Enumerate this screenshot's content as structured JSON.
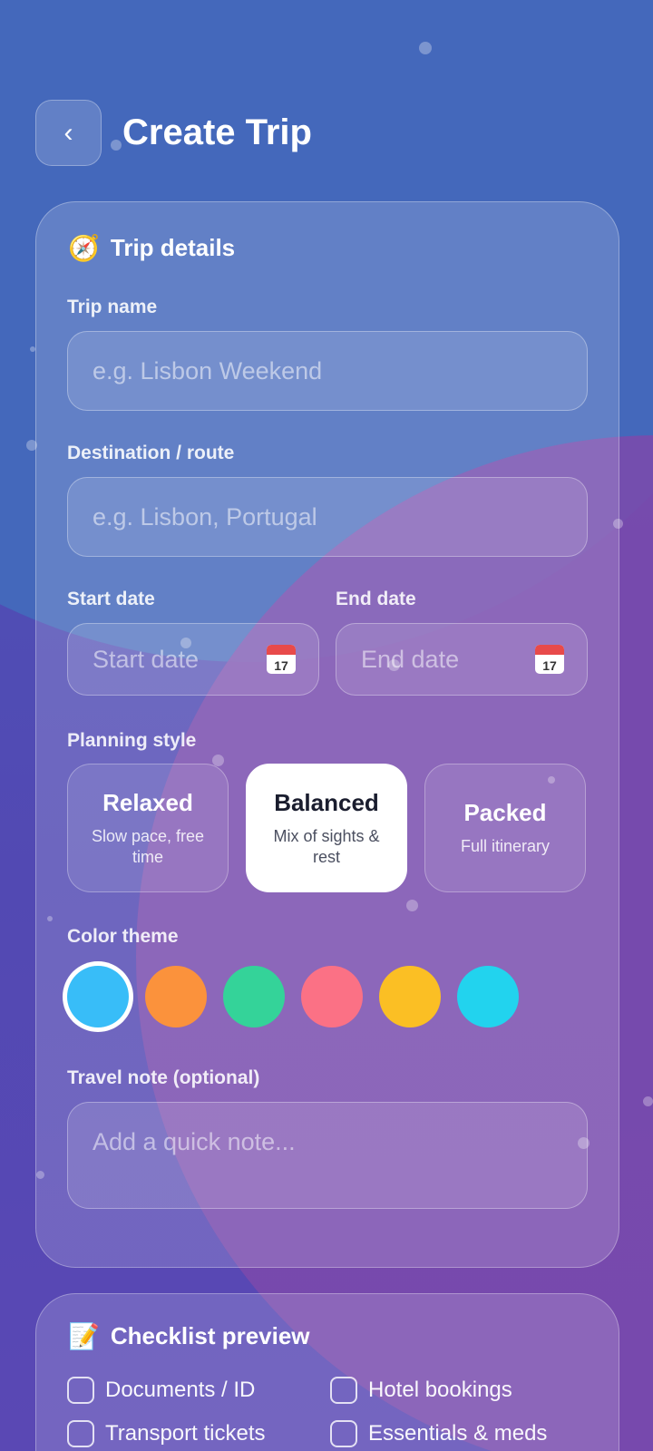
{
  "header": {
    "back_glyph": "‹",
    "title": "Create Trip"
  },
  "trip_details": {
    "emoji": "🧭",
    "title": "Trip details",
    "trip_name": {
      "label": "Trip name",
      "placeholder": "e.g. Lisbon Weekend",
      "value": ""
    },
    "destination": {
      "label": "Destination / route",
      "placeholder": "e.g. Lisbon, Portugal",
      "value": ""
    },
    "start_date": {
      "label": "Start date",
      "placeholder": "Start date",
      "icon": "calendar-icon",
      "icon_text": "17"
    },
    "end_date": {
      "label": "End date",
      "placeholder": "End date",
      "icon": "calendar-icon",
      "icon_text": "17"
    },
    "planning_style": {
      "label": "Planning style",
      "options": [
        {
          "name": "Relaxed",
          "desc": "Slow pace, free time",
          "selected": false
        },
        {
          "name": "Balanced",
          "desc": "Mix of sights & rest",
          "selected": true
        },
        {
          "name": "Packed",
          "desc": "Full itinerary",
          "selected": false
        }
      ]
    },
    "color_theme": {
      "label": "Color theme",
      "colors": [
        "#38bdf8",
        "#fb923c",
        "#34d399",
        "#fb7185",
        "#fbbf24",
        "#22d3ee"
      ],
      "selected_index": 0
    },
    "travel_note": {
      "label": "Travel note (optional)",
      "placeholder": "Add a quick note..."
    }
  },
  "checklist": {
    "emoji": "📝",
    "title": "Checklist preview",
    "items": [
      "Documents / ID",
      "Hotel bookings",
      "Transport tickets",
      "Essentials & meds"
    ]
  }
}
